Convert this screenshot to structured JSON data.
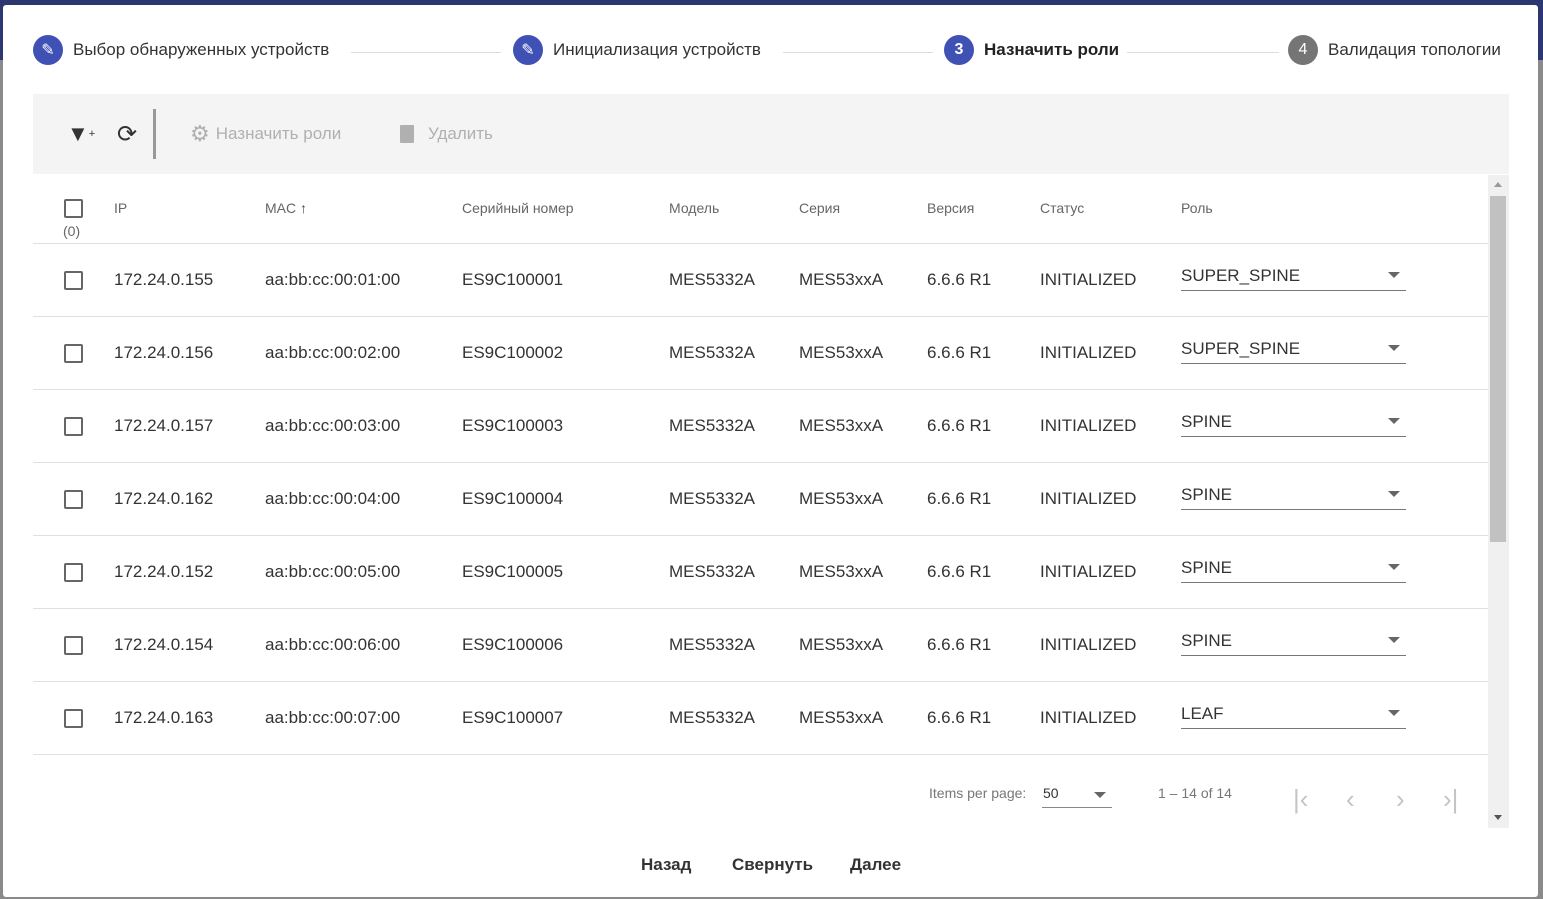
{
  "stepper": [
    {
      "num": "",
      "label": "Выбор обнаруженных устройств",
      "state": "edit"
    },
    {
      "num": "",
      "label": "Инициализация устройств",
      "state": "edit"
    },
    {
      "num": "3",
      "label": "Назначить роли",
      "state": "active"
    },
    {
      "num": "4",
      "label": "Валидация топологии",
      "state": "pending"
    }
  ],
  "toolbar": {
    "assign_roles": "Назначить роли",
    "delete": "Удалить"
  },
  "table": {
    "select_count": "(0)",
    "columns": [
      "IP",
      "MAC",
      "Серийный номер",
      "Модель",
      "Серия",
      "Версия",
      "Статус",
      "Роль"
    ],
    "rows": [
      {
        "ip": "172.24.0.155",
        "mac": "aa:bb:cc:00:01:00",
        "serial": "ES9C100001",
        "model": "MES5332A",
        "series": "MES53xxA",
        "version": "6.6.6 R1",
        "status": "INITIALIZED",
        "role": "SUPER_SPINE"
      },
      {
        "ip": "172.24.0.156",
        "mac": "aa:bb:cc:00:02:00",
        "serial": "ES9C100002",
        "model": "MES5332A",
        "series": "MES53xxA",
        "version": "6.6.6 R1",
        "status": "INITIALIZED",
        "role": "SUPER_SPINE"
      },
      {
        "ip": "172.24.0.157",
        "mac": "aa:bb:cc:00:03:00",
        "serial": "ES9C100003",
        "model": "MES5332A",
        "series": "MES53xxA",
        "version": "6.6.6 R1",
        "status": "INITIALIZED",
        "role": "SPINE"
      },
      {
        "ip": "172.24.0.162",
        "mac": "aa:bb:cc:00:04:00",
        "serial": "ES9C100004",
        "model": "MES5332A",
        "series": "MES53xxA",
        "version": "6.6.6 R1",
        "status": "INITIALIZED",
        "role": "SPINE"
      },
      {
        "ip": "172.24.0.152",
        "mac": "aa:bb:cc:00:05:00",
        "serial": "ES9C100005",
        "model": "MES5332A",
        "series": "MES53xxA",
        "version": "6.6.6 R1",
        "status": "INITIALIZED",
        "role": "SPINE"
      },
      {
        "ip": "172.24.0.154",
        "mac": "aa:bb:cc:00:06:00",
        "serial": "ES9C100006",
        "model": "MES5332A",
        "series": "MES53xxA",
        "version": "6.6.6 R1",
        "status": "INITIALIZED",
        "role": "SPINE"
      },
      {
        "ip": "172.24.0.163",
        "mac": "aa:bb:cc:00:07:00",
        "serial": "ES9C100007",
        "model": "MES5332A",
        "series": "MES53xxA",
        "version": "6.6.6 R1",
        "status": "INITIALIZED",
        "role": "LEAF"
      }
    ]
  },
  "paginator": {
    "label": "Items per page:",
    "page_size": "50",
    "range": "1 – 14 of 14"
  },
  "footer": {
    "back": "Назад",
    "collapse": "Свернуть",
    "next": "Далее"
  }
}
